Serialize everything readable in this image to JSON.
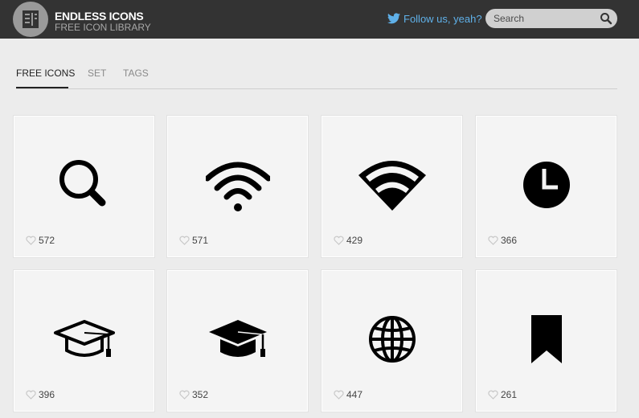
{
  "header": {
    "brand_title": "ENDLESS ICONS",
    "brand_subtitle": "FREE ICON LIBRARY",
    "follow_label": "Follow us, yeah?",
    "search_placeholder": "Search"
  },
  "tabs": [
    {
      "label": "FREE ICONS",
      "active": true
    },
    {
      "label": "SET",
      "active": false
    },
    {
      "label": "TAGS",
      "active": false
    }
  ],
  "icons": [
    {
      "icon": "magnifier-icon",
      "likes": "572"
    },
    {
      "icon": "wifi-icon",
      "likes": "571"
    },
    {
      "icon": "wifi-filled-icon",
      "likes": "429"
    },
    {
      "icon": "clock-icon",
      "likes": "366"
    },
    {
      "icon": "graduation-cap-outline-icon",
      "likes": "396"
    },
    {
      "icon": "graduation-cap-icon",
      "likes": "352"
    },
    {
      "icon": "globe-icon",
      "likes": "447"
    },
    {
      "icon": "bookmark-icon",
      "likes": "261"
    }
  ],
  "colors": {
    "header_bg": "#333333",
    "twitter_blue": "#5fb0e8",
    "page_bg": "#ececec",
    "card_bg": "#f4f4f4"
  }
}
